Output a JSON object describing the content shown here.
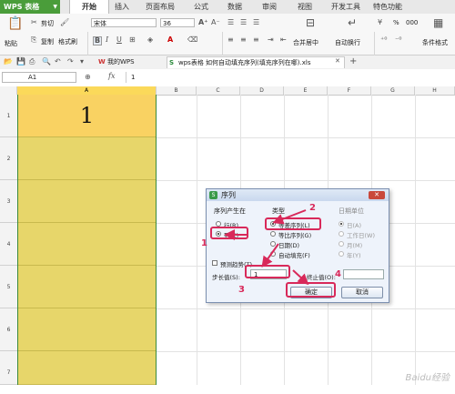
{
  "app": {
    "name": "WPS 表格"
  },
  "menu_tabs": [
    "开始",
    "插入",
    "页面布局",
    "公式",
    "数据",
    "审阅",
    "视图",
    "开发工具",
    "特色功能"
  ],
  "ribbon": {
    "paste": "粘贴",
    "cut": "剪切",
    "copy": "复制",
    "format_painter": "格式刷",
    "font_name": "宋体",
    "font_size": "36",
    "merge_center": "合并居中",
    "wrap_text": "自动换行",
    "conditional_format": "条件格式",
    "percent": "%",
    "thousands": "000"
  },
  "file_tabs": [
    {
      "label": "我的WPS"
    },
    {
      "label": "wps表格 如何自动填充序列(填充序列在哪).xls"
    }
  ],
  "formula_bar": {
    "name_box": "A1",
    "fx": "fx",
    "value": "1"
  },
  "columns": [
    "A",
    "B",
    "C",
    "D",
    "E",
    "F",
    "G",
    "H"
  ],
  "rows": [
    "1",
    "2",
    "3",
    "4",
    "5",
    "6",
    "7"
  ],
  "cell_a1": "1",
  "dialog": {
    "title": "序列",
    "group_series_in": "序列产生在",
    "opt_row": "行(R)",
    "opt_column": "列(C)",
    "group_type": "类型",
    "opt_linear": "等差序列(L)",
    "opt_growth": "等比序列(G)",
    "opt_date": "日期(D)",
    "opt_autofill": "自动填充(F)",
    "group_date_unit": "日期单位",
    "opt_day": "日(A)",
    "opt_weekday": "工作日(W)",
    "opt_month": "月(M)",
    "opt_year": "年(Y)",
    "trend": "预测趋势(T)",
    "step_label": "步长值(S):",
    "step_value": "1",
    "stop_label": "终止值(O):",
    "stop_value": "",
    "ok": "确定",
    "cancel": "取消",
    "close": "✕"
  },
  "annotations": [
    "1",
    "2",
    "3",
    "4"
  ],
  "watermark": "Baidu经验",
  "colors": {
    "accent": "#d8295a",
    "app_green": "#4a9d3a",
    "cell_fill": "#e7d66a",
    "a1_fill": "#f9d262"
  }
}
